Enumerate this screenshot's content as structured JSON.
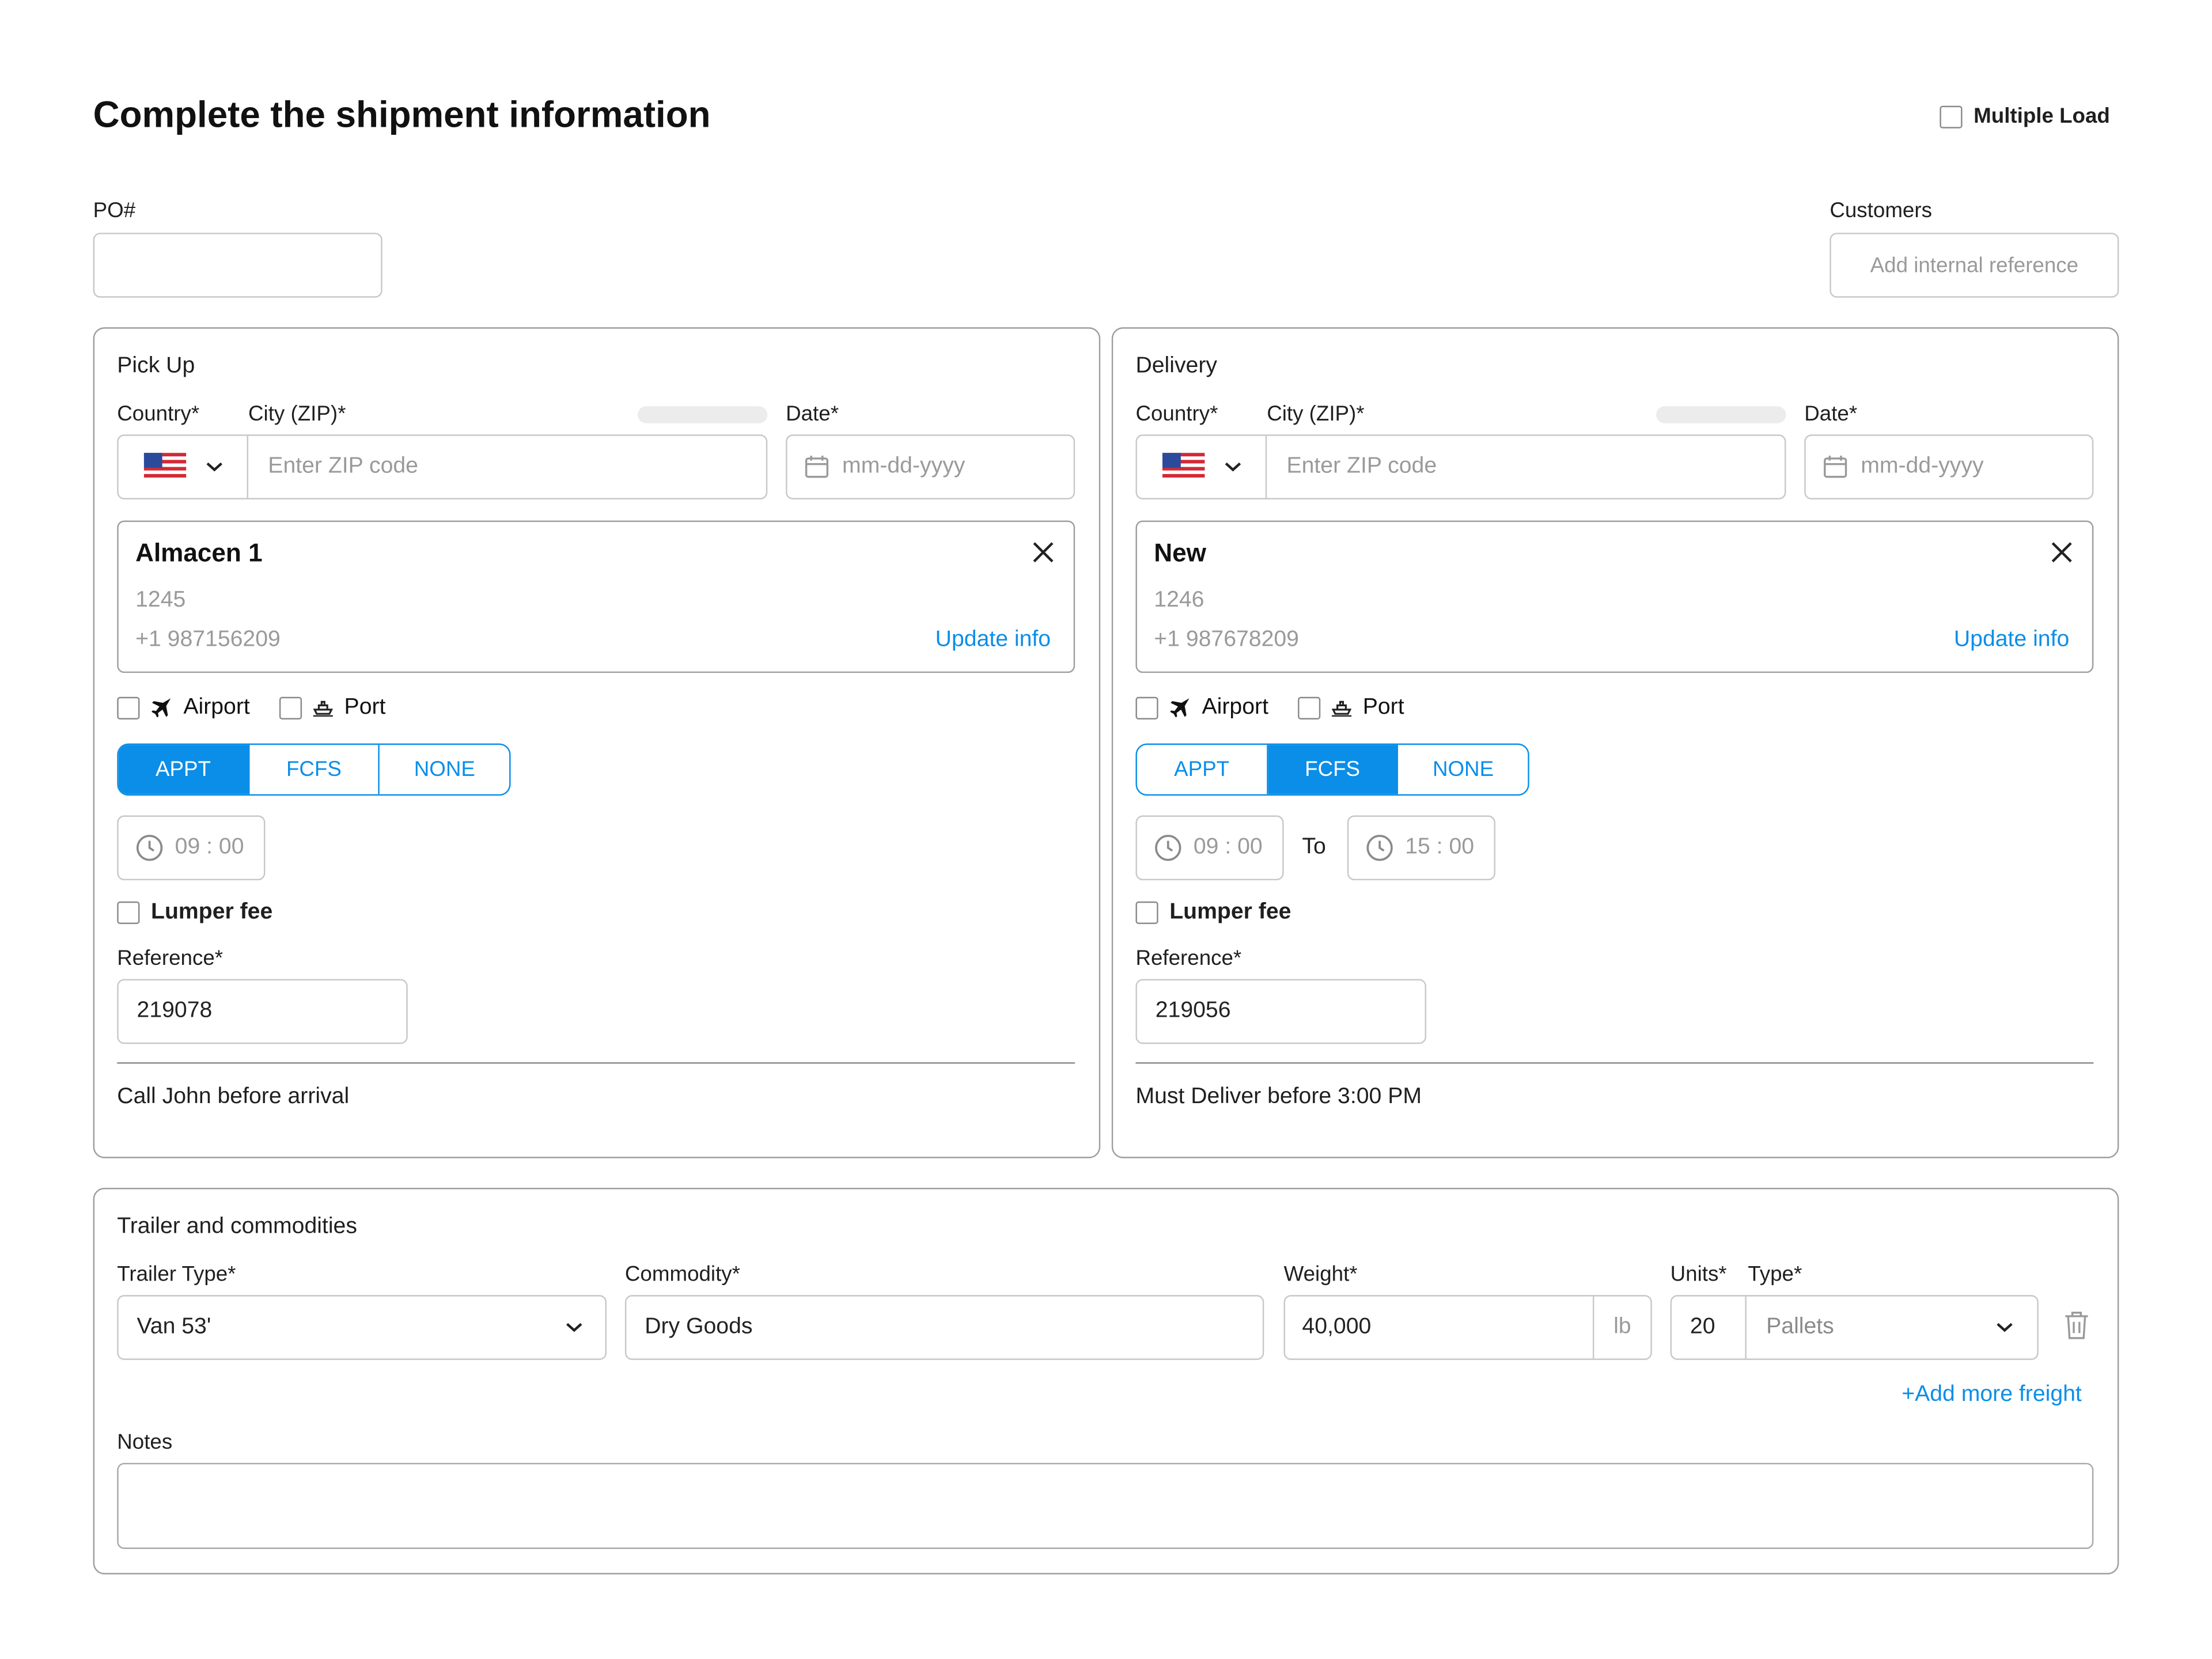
{
  "header": {
    "title": "Complete the shipment information",
    "multiple_load_label": "Multiple Load"
  },
  "po": {
    "label": "PO#",
    "value": ""
  },
  "customers": {
    "label": "Customers",
    "placeholder": "Add internal reference"
  },
  "pickup": {
    "section_label": "Pick Up",
    "country_label": "Country*",
    "city_label": "City (ZIP)*",
    "date_label": "Date*",
    "zip_placeholder": "Enter ZIP code",
    "date_placeholder": "mm-dd-yyyy",
    "location": {
      "name": "Almacen 1",
      "code": "1245",
      "phone": "+1 987156209",
      "update_label": "Update info"
    },
    "airport_label": "Airport",
    "port_label": "Port",
    "modes": [
      "APPT",
      "FCFS",
      "NONE"
    ],
    "active_mode": "APPT",
    "time_start": "09 : 00",
    "lumper_label": "Lumper fee",
    "reference_label": "Reference*",
    "reference_value": "219078",
    "note": "Call John before arrival"
  },
  "delivery": {
    "section_label": "Delivery",
    "country_label": "Country*",
    "city_label": "City (ZIP)*",
    "date_label": "Date*",
    "zip_placeholder": "Enter ZIP code",
    "date_placeholder": "mm-dd-yyyy",
    "location": {
      "name": "New",
      "code": "1246",
      "phone": "+1 987678209",
      "update_label": "Update info"
    },
    "airport_label": "Airport",
    "port_label": "Port",
    "modes": [
      "APPT",
      "FCFS",
      "NONE"
    ],
    "active_mode": "FCFS",
    "time_start": "09 : 00",
    "to_label": "To",
    "time_end": "15 : 00",
    "lumper_label": "Lumper fee",
    "reference_label": "Reference*",
    "reference_value": "219056",
    "note": "Must Deliver before 3:00 PM"
  },
  "trailer": {
    "section_label": "Trailer and commodities",
    "trailer_type_label": "Trailer Type*",
    "trailer_type_value": "Van 53'",
    "commodity_label": "Commodity*",
    "commodity_value": "Dry Goods",
    "weight_label": "Weight*",
    "weight_value": "40,000",
    "weight_unit": "lb",
    "units_label": "Units*",
    "units_value": "20",
    "type_label": "Type*",
    "type_value": "Pallets",
    "add_more_label": "+Add more freight",
    "notes_label": "Notes",
    "notes_value": ""
  },
  "colors": {
    "accent": "#0a8ee8",
    "border": "#c8c8c8",
    "panel_border": "#9e9e9e"
  },
  "icons": [
    "us-flag-icon",
    "chevron-down-icon",
    "calendar-icon",
    "close-icon",
    "airplane-icon",
    "ship-icon",
    "clock-icon",
    "trash-icon"
  ]
}
